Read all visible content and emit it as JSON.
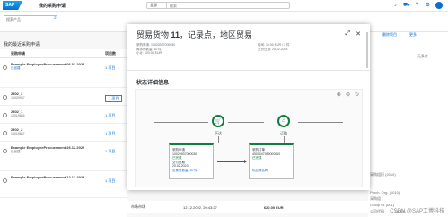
{
  "shell": {
    "logo": "SAP",
    "app_title": "我的采购申请",
    "search_scope": "全部",
    "search_placeholder": "搜索"
  },
  "filter": {
    "placeholder": "搜索产品"
  },
  "list": {
    "title": "我的最近采购申请",
    "headers": [
      "采购申请",
      "项目数"
    ],
    "rows": [
      {
        "title": "Example EmployeeProcurement 06.02.2023",
        "sub": "已创建",
        "sub_blue": true,
        "count": "1 项目"
      },
      {
        "title": "2302_3",
        "sub": "10020937",
        "sub_blue": false,
        "count": "1 项目"
      },
      {
        "title": "2302_1",
        "sub": "10019684",
        "sub_blue": false,
        "count": "1 项目"
      },
      {
        "title": "2302_2",
        "sub": "10019687",
        "sub_blue": false,
        "count": "1 项目"
      },
      {
        "title": "Example EmployeeProcurement 26.12.2022",
        "sub": "已创建",
        "sub_blue": false,
        "count": "1 项目"
      },
      {
        "title": "Example EmployeeProcurement 12.12.2022",
        "sub": "",
        "sub_blue": false,
        "count": "1 项目"
      }
    ]
  },
  "modal": {
    "title_prefix": "贸易货物",
    "title_num": "11",
    "title_suffix": "，记录点，地区贸易",
    "kv_left": [
      "采购申请: 10020937000030",
      "需求的数量: 10 件",
      "小计: 100.00 EUR"
    ],
    "kv_right": [
      "时间: 10.00 EUR / 1 件",
      "交货日期: 20.02.2023"
    ],
    "section_title": "状态详细信息",
    "zoom_icons": [
      "zoom-in",
      "zoom-out",
      "reset"
    ],
    "nodes": [
      {
        "label": "下达",
        "icon": "cart"
      },
      {
        "label": "订购",
        "icon": "factory"
      }
    ],
    "cards": [
      {
        "title": "采购申请",
        "id": "10020937000030",
        "status": "已完成",
        "extra": "交付日期",
        "date": "20.02.2023",
        "foot": "总累计数量: 10 件"
      },
      {
        "title": "采购订单",
        "id": "4500047989000010",
        "status": "已完成",
        "extra": "",
        "date": "",
        "foot": "供应商名称"
      }
    ]
  },
  "bottom_row": {
    "label": "市场市场",
    "date": "12.12.2022, 20:43:27",
    "amount": "620.00 EUR"
  },
  "right_panel": {
    "tabs": [
      "删除项目",
      "更多"
    ],
    "labels": [
      "无条件",
      "采购组织 (2010)",
      "Purch. Org. (1010)",
      "采购组",
      "Group 01 (001)",
      "公司代码",
      "(1010)"
    ]
  },
  "watermark": "CSDN @SAP工博科技"
}
